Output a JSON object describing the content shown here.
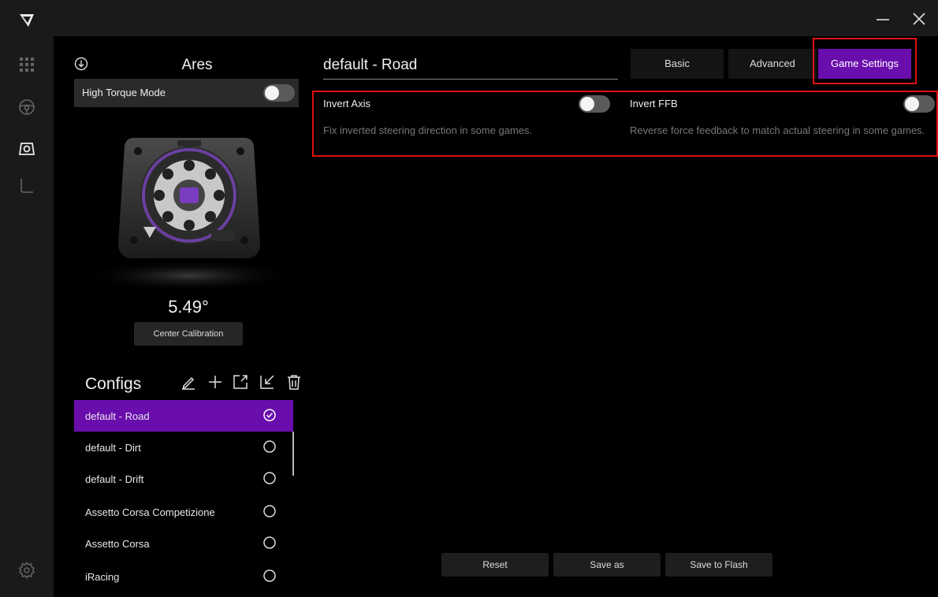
{
  "device": {
    "name": "Ares",
    "high_torque_label": "High Torque Mode",
    "angle": "5.49°",
    "center_calibration_label": "Center Calibration"
  },
  "configs": {
    "title": "Configs",
    "items": [
      {
        "label": "default - Road",
        "selected": true
      },
      {
        "label": "default - Dirt",
        "selected": false
      },
      {
        "label": "default - Drift",
        "selected": false
      },
      {
        "label": "Assetto Corsa Competizione",
        "selected": false
      },
      {
        "label": "Assetto Corsa",
        "selected": false
      },
      {
        "label": "iRacing",
        "selected": false
      }
    ]
  },
  "main": {
    "profile_name": "default - Road",
    "tabs": [
      {
        "label": "Basic",
        "active": false
      },
      {
        "label": "Advanced",
        "active": false
      },
      {
        "label": "Game Settings",
        "active": true
      }
    ],
    "settings": [
      {
        "label": "Invert Axis",
        "description": "Fix inverted steering direction in some games."
      },
      {
        "label": "Invert FFB",
        "description": "Reverse force feedback to match actual steering in some games."
      }
    ],
    "buttons": {
      "reset": "Reset",
      "save_as": "Save as",
      "save_to_flash": "Save to Flash"
    }
  },
  "colors": {
    "accent": "#6a0dad",
    "highlight": "#e01010",
    "rail_bg": "#1a1a1a"
  },
  "icons": {
    "logo": "brand-logo-icon",
    "rail": [
      "apps-grid-icon",
      "steering-wheel-icon",
      "wheelbase-icon",
      "pedals-icon",
      "settings-gear-icon"
    ],
    "config_tools": [
      "edit-icon",
      "add-icon",
      "export-icon",
      "import-icon",
      "delete-icon"
    ]
  }
}
